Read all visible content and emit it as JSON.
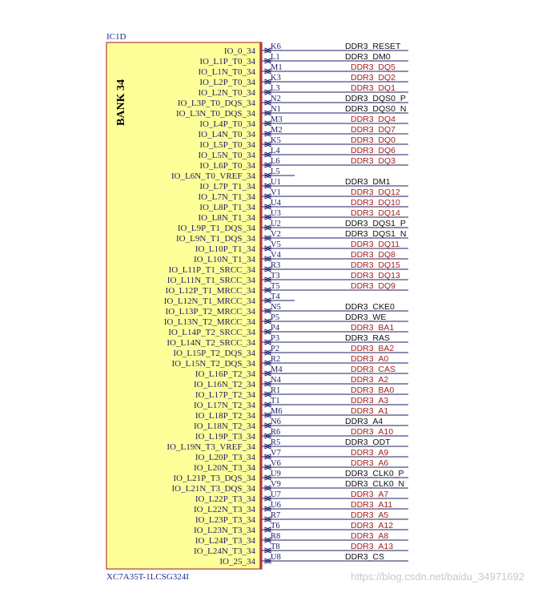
{
  "designator": "IC1D",
  "bank_label": "BANK 34",
  "part_number": "XC7A35T-1LCSG324I",
  "watermark": "https://blog.csdn.net/baidu_34971692",
  "colors": {
    "body_fill": "#ffff99",
    "body_border": "#b23a3a",
    "wire": "#1c1c66",
    "net_black": "#111111",
    "net_red": "#a0221e"
  },
  "pins": [
    {
      "name": "IO_0_34",
      "pin": "K6",
      "net": "DDR3_RESET",
      "net_color": "black"
    },
    {
      "name": "IO_L1P_T0_34",
      "pin": "L1",
      "net": "DDR3_DM0",
      "net_color": "black"
    },
    {
      "name": "IO_L1N_T0_34",
      "pin": "M1",
      "net": "DDR3_DQ5",
      "net_color": "red"
    },
    {
      "name": "IO_L2P_T0_34",
      "pin": "K3",
      "net": "DDR3_DQ2",
      "net_color": "red"
    },
    {
      "name": "IO_L2N_T0_34",
      "pin": "L3",
      "net": "DDR3_DQ1",
      "net_color": "red"
    },
    {
      "name": "IO_L3P_T0_DQS_34",
      "pin": "N2",
      "net": "DDR3_DQS0_P",
      "net_color": "black"
    },
    {
      "name": "IO_L3N_T0_DQS_34",
      "pin": "N1",
      "net": "DDR3_DQS0_N",
      "net_color": "black"
    },
    {
      "name": "IO_L4P_T0_34",
      "pin": "M3",
      "net": "DDR3_DQ4",
      "net_color": "red"
    },
    {
      "name": "IO_L4N_T0_34",
      "pin": "M2",
      "net": "DDR3_DQ7",
      "net_color": "red"
    },
    {
      "name": "IO_L5P_T0_34",
      "pin": "K5",
      "net": "DDR3_DQ0",
      "net_color": "red"
    },
    {
      "name": "IO_L5N_T0_34",
      "pin": "L4",
      "net": "DDR3_DQ6",
      "net_color": "red"
    },
    {
      "name": "IO_L6P_T0_34",
      "pin": "L6",
      "net": "DDR3_DQ3",
      "net_color": "red"
    },
    {
      "name": "IO_L6N_T0_VREF_34",
      "pin": "L5",
      "net": "",
      "net_color": "none"
    },
    {
      "name": "IO_L7P_T1_34",
      "pin": "U1",
      "net": "DDR3_DM1",
      "net_color": "black"
    },
    {
      "name": "IO_L7N_T1_34",
      "pin": "V1",
      "net": "DDR3_DQ12",
      "net_color": "red"
    },
    {
      "name": "IO_L8P_T1_34",
      "pin": "U4",
      "net": "DDR3_DQ10",
      "net_color": "red"
    },
    {
      "name": "IO_L8N_T1_34",
      "pin": "U3",
      "net": "DDR3_DQ14",
      "net_color": "red"
    },
    {
      "name": "IO_L9P_T1_DQS_34",
      "pin": "U2",
      "net": "DDR3_DQS1_P",
      "net_color": "black"
    },
    {
      "name": "IO_L9N_T1_DQS_34",
      "pin": "V2",
      "net": "DDR3_DQS1_N",
      "net_color": "black"
    },
    {
      "name": "IO_L10P_T1_34",
      "pin": "V5",
      "net": "DDR3_DQ11",
      "net_color": "red"
    },
    {
      "name": "IO_L10N_T1_34",
      "pin": "V4",
      "net": "DDR3_DQ8",
      "net_color": "red"
    },
    {
      "name": "IO_L11P_T1_SRCC_34",
      "pin": "R3",
      "net": "DDR3_DQ15",
      "net_color": "red"
    },
    {
      "name": "IO_L11N_T1_SRCC_34",
      "pin": "T3",
      "net": "DDR3_DQ13",
      "net_color": "red"
    },
    {
      "name": "IO_L12P_T1_MRCC_34",
      "pin": "T5",
      "net": "DDR3_DQ9",
      "net_color": "red"
    },
    {
      "name": "IO_L12N_T1_MRCC_34",
      "pin": "T4",
      "net": "",
      "net_color": "none"
    },
    {
      "name": "IO_L13P_T2_MRCC_34",
      "pin": "N5",
      "net": "DDR3_CKE0",
      "net_color": "black"
    },
    {
      "name": "IO_L13N_T2_MRCC_34",
      "pin": "P5",
      "net": "DDR3_WE",
      "net_color": "black"
    },
    {
      "name": "IO_L14P_T2_SRCC_34",
      "pin": "P4",
      "net": "DDR3_BA1",
      "net_color": "red"
    },
    {
      "name": "IO_L14N_T2_SRCC_34",
      "pin": "P3",
      "net": "DDR3_RAS",
      "net_color": "black"
    },
    {
      "name": "IO_L15P_T2_DQS_34",
      "pin": "P2",
      "net": "DDR3_BA2",
      "net_color": "red"
    },
    {
      "name": "IO_L15N_T2_DQS_34",
      "pin": "R2",
      "net": "DDR3_A0",
      "net_color": "red"
    },
    {
      "name": "IO_L16P_T2_34",
      "pin": "M4",
      "net": "DDR3_CAS",
      "net_color": "red"
    },
    {
      "name": "IO_L16N_T2_34",
      "pin": "N4",
      "net": "DDR3_A2",
      "net_color": "red"
    },
    {
      "name": "IO_L17P_T2_34",
      "pin": "R1",
      "net": "DDR3_BA0",
      "net_color": "red"
    },
    {
      "name": "IO_L17N_T2_34",
      "pin": "T1",
      "net": "DDR3_A3",
      "net_color": "red"
    },
    {
      "name": "IO_L18P_T2_34",
      "pin": "M6",
      "net": "DDR3_A1",
      "net_color": "red"
    },
    {
      "name": "IO_L18N_T2_34",
      "pin": "N6",
      "net": "DDR3_A4",
      "net_color": "black"
    },
    {
      "name": "IO_L19P_T3_34",
      "pin": "R6",
      "net": "DDR3_A10",
      "net_color": "red"
    },
    {
      "name": "IO_L19N_T3_VREF_34",
      "pin": "R5",
      "net": "DDR3_ODT",
      "net_color": "black"
    },
    {
      "name": "IO_L20P_T3_34",
      "pin": "V7",
      "net": "DDR3_A9",
      "net_color": "red"
    },
    {
      "name": "IO_L20N_T3_34",
      "pin": "V6",
      "net": "DDR3_A6",
      "net_color": "red"
    },
    {
      "name": "IO_L21P_T3_DQS_34",
      "pin": "U9",
      "net": "DDR3_CLK0_P",
      "net_color": "black"
    },
    {
      "name": "IO_L21N_T3_DQS_34",
      "pin": "V9",
      "net": "DDR3_CLK0_N",
      "net_color": "black"
    },
    {
      "name": "IO_L22P_T3_34",
      "pin": "U7",
      "net": "DDR3_A7",
      "net_color": "red"
    },
    {
      "name": "IO_L22N_T3_34",
      "pin": "U6",
      "net": "DDR3_A11",
      "net_color": "red"
    },
    {
      "name": "IO_L23P_T3_34",
      "pin": "R7",
      "net": "DDR3_A5",
      "net_color": "red"
    },
    {
      "name": "IO_L23N_T3_34",
      "pin": "T6",
      "net": "DDR3_A12",
      "net_color": "red"
    },
    {
      "name": "IO_L24P_T3_34",
      "pin": "R8",
      "net": "DDR3_A8",
      "net_color": "red"
    },
    {
      "name": "IO_L24N_T3_34",
      "pin": "T8",
      "net": "DDR3_A13",
      "net_color": "red"
    },
    {
      "name": "IO_25_34",
      "pin": "U8",
      "net": "DDR3_CS",
      "net_color": "black"
    }
  ]
}
